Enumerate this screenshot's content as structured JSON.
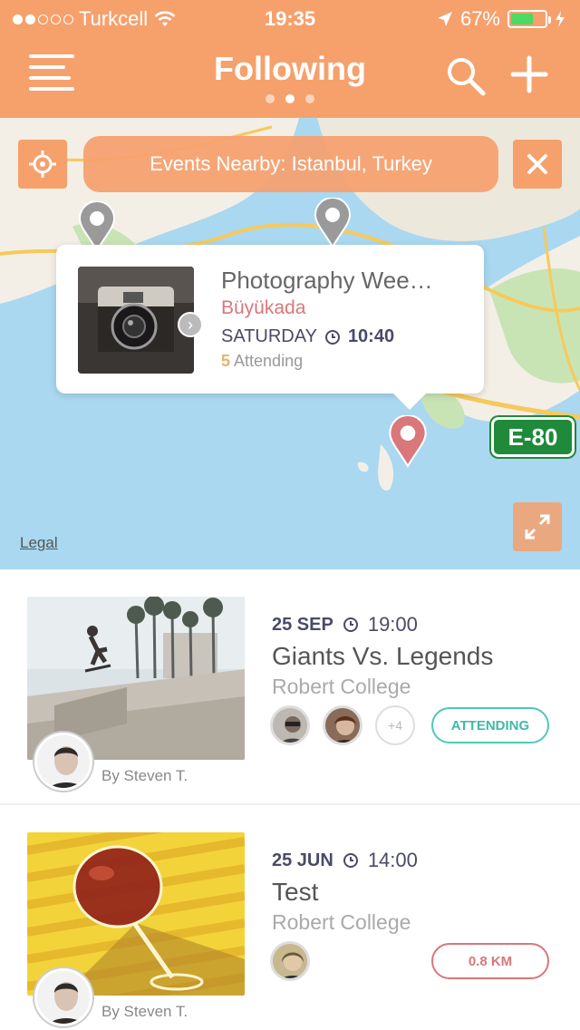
{
  "status": {
    "carrier": "Turkcell",
    "time": "19:35",
    "battery": "67%",
    "signal_bars_filled": 2,
    "signal_bars_total": 5,
    "battery_level": 0.67
  },
  "header": {
    "title": "Following",
    "pager_count": 3,
    "pager_active": 1,
    "accent_color": "#f6a06c"
  },
  "map": {
    "nearby_label": "Events Nearby: Istanbul, Turkey",
    "legal": "Legal",
    "road_shield": "E-80",
    "callout": {
      "title": "Photography Wee…",
      "place": "Büyükada",
      "day": "SATURDAY",
      "time": "10:40",
      "attending_count": "5",
      "attending_label": "Attending"
    }
  },
  "feed": [
    {
      "date": "25 SEP",
      "time": "19:00",
      "title": "Giants Vs. Legends",
      "place": "Robert College",
      "by": "By Steven T.",
      "more_attendees": "+4",
      "action": "ATTENDING"
    },
    {
      "date": "25 JUN",
      "time": "14:00",
      "title": "Test",
      "place": "Robert College",
      "by": "By Steven T.",
      "action": "0.8 KM"
    }
  ],
  "colors": {
    "attending": "#3dbba9",
    "distance": "#d9777b",
    "place": "#d9777b"
  }
}
